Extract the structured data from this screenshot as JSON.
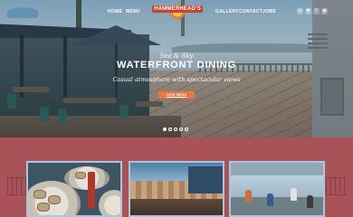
{
  "nav": {
    "home": "HOME",
    "menu": "MENU",
    "gallery": "GALLERY",
    "contact": "CONTACT",
    "jobs": "JOBS",
    "logo_text": "HAMMERHEAD'S"
  },
  "social": {
    "icons": [
      "instagram-icon",
      "yelp-icon",
      "facebook-icon",
      "tripadvisor-icon"
    ],
    "glyphs": [
      "◎",
      "✱",
      "f",
      "◉"
    ]
  },
  "hero": {
    "eyebrow": "Sea & Sky",
    "headline": "WATERFRONT DINING",
    "tagline": "Casual atmosphere with spectacular views",
    "cta_label": "VIEW MENU",
    "slides_total": 5,
    "slide_active": 1
  },
  "colors": {
    "section_bg": "#a95257",
    "cta": "#e97a3d",
    "card_border": "#a9c6de",
    "logo_red": "#c8442f"
  }
}
